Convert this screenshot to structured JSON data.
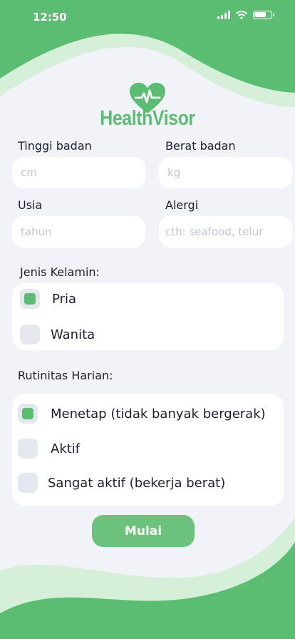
{
  "status_bar": {
    "time": "12:50",
    "icons": [
      "signal-icon",
      "wifi-icon",
      "battery-icon"
    ]
  },
  "brand": {
    "name": "HealthVisor",
    "icon": "heart-pulse-icon"
  },
  "colors": {
    "accent": "#5bbd72",
    "button": "#6cc17d",
    "background": "#f1f3f8",
    "light_wave": "#d6efd9"
  },
  "form": {
    "height": {
      "label": "Tinggi badan",
      "placeholder": "cm",
      "value": ""
    },
    "weight": {
      "label": "Berat badan",
      "placeholder": "kg",
      "value": ""
    },
    "age": {
      "label": "Usia",
      "placeholder": "tahun",
      "value": ""
    },
    "allergy": {
      "label": "Alergi",
      "placeholder": "cth: seafood, telur",
      "value": ""
    },
    "gender": {
      "label": "Jenis Kelamin:",
      "options": [
        {
          "label": "Pria",
          "checked": true
        },
        {
          "label": "Wanita",
          "checked": false
        }
      ]
    },
    "activity": {
      "label": "Rutinitas Harian:",
      "options": [
        {
          "label": "Menetap (tidak banyak bergerak)",
          "checked": true
        },
        {
          "label": "Aktif",
          "checked": false
        },
        {
          "label": "Sangat aktif (bekerja berat)",
          "checked": false
        }
      ]
    },
    "submit_label": "Mulai"
  }
}
